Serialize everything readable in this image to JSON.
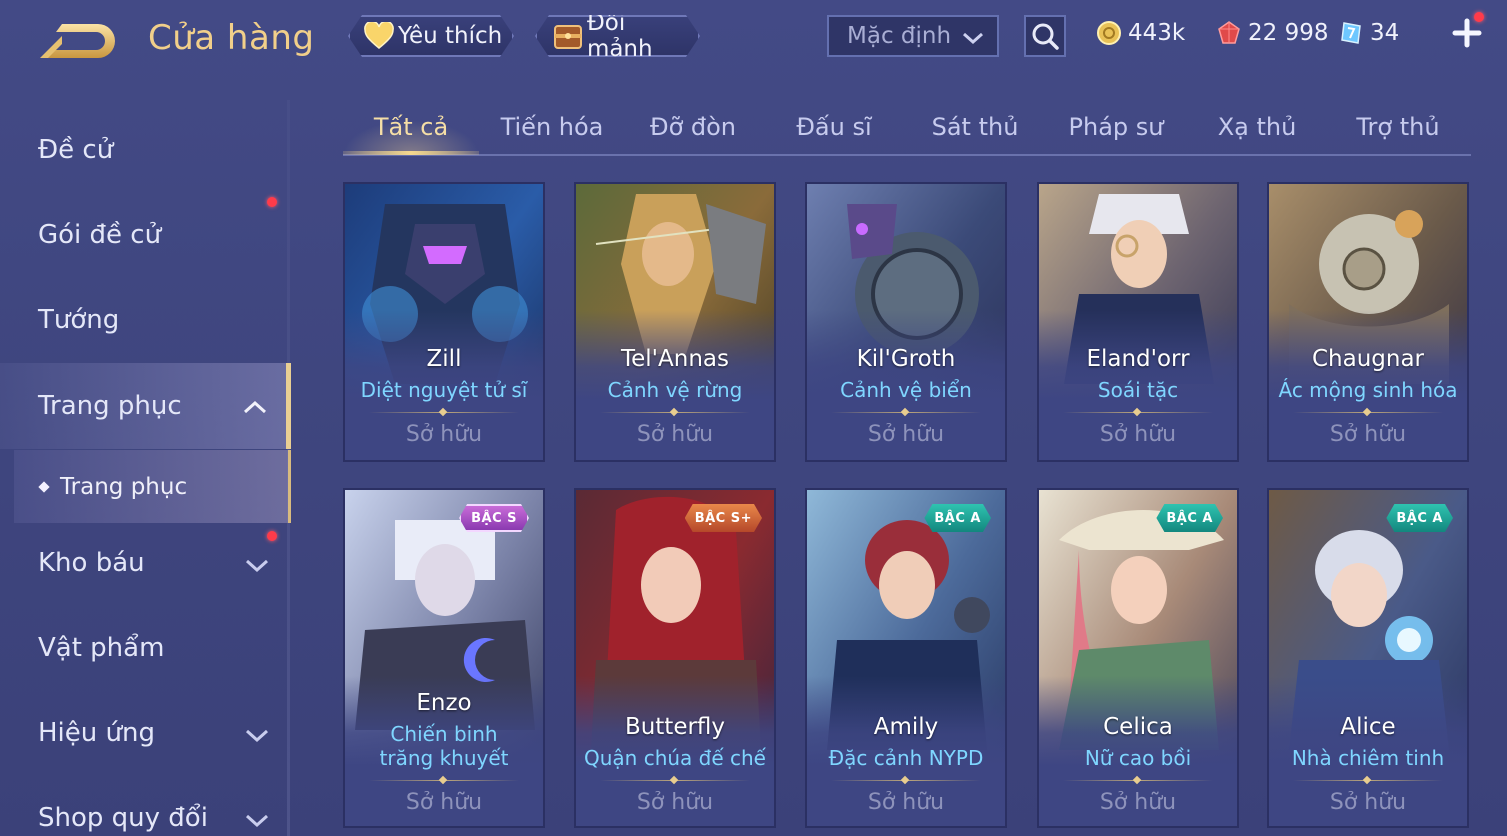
{
  "header": {
    "title": "Cửa hàng",
    "favorite_label": "Yêu thích",
    "shard_label": "Đổi mảnh",
    "sort_value": "Mặc định"
  },
  "currency": {
    "gold": "443k",
    "ruby": "22 998",
    "voucher": "34"
  },
  "sidebar": {
    "items": [
      {
        "label": "Đề cử"
      },
      {
        "label": "Gói đề cử"
      },
      {
        "label": "Tướng"
      },
      {
        "label": "Trang phục"
      },
      {
        "label": "Kho báu"
      },
      {
        "label": "Vật phẩm"
      },
      {
        "label": "Hiệu ứng"
      },
      {
        "label": "Shop quy đổi"
      }
    ],
    "sub_item": "Trang phục"
  },
  "tabs": [
    "Tất cả",
    "Tiến hóa",
    "Đỡ đòn",
    "Đấu sĩ",
    "Sát thủ",
    "Pháp sư",
    "Xạ thủ",
    "Trợ thủ"
  ],
  "cards": [
    {
      "hero": "Zill",
      "skin": "Diệt nguyệt tử sĩ",
      "status": "Sở hữu"
    },
    {
      "hero": "Tel'Annas",
      "skin": "Cảnh vệ rừng",
      "status": "Sở hữu"
    },
    {
      "hero": "Kil'Groth",
      "skin": "Cảnh vệ biển",
      "status": "Sở hữu"
    },
    {
      "hero": "Eland'orr",
      "skin": "Soái tặc",
      "status": "Sở hữu"
    },
    {
      "hero": "Chaugnar",
      "skin": "Ác mộng sinh hóa",
      "status": "Sở hữu"
    },
    {
      "hero": "Enzo",
      "skin": "Chiến binh trăng khuyết",
      "status": "Sở hữu",
      "badge": "BẬC S"
    },
    {
      "hero": "Butterfly",
      "skin": "Quận chúa đế chế",
      "status": "Sở hữu",
      "badge": "BẬC S+"
    },
    {
      "hero": "Amily",
      "skin": "Đặc cảnh NYPD",
      "status": "Sở hữu",
      "badge": "BẬC A"
    },
    {
      "hero": "Celica",
      "skin": "Nữ cao bồi",
      "status": "Sở hữu",
      "badge": "BẬC A"
    },
    {
      "hero": "Alice",
      "skin": "Nhà chiêm tinh",
      "status": "Sở hữu",
      "badge": "BẬC A"
    }
  ],
  "colors": {
    "title_gold": "#f1cf8a",
    "skin_name": "#7fd6ff",
    "notification": "#ff3b4a"
  }
}
